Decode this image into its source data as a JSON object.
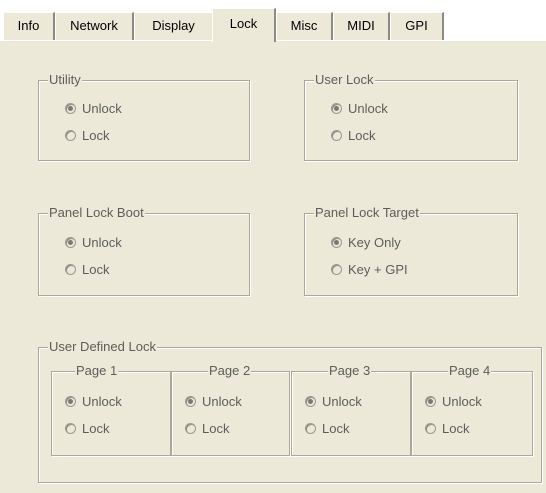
{
  "tabs": [
    {
      "label": "Info"
    },
    {
      "label": "Network"
    },
    {
      "label": "Display"
    },
    {
      "label": "Lock"
    },
    {
      "label": "Misc"
    },
    {
      "label": "MIDI"
    },
    {
      "label": "GPI"
    }
  ],
  "active_tab": "Lock",
  "utility": {
    "title": "Utility",
    "unlock": "Unlock",
    "lock": "Lock",
    "selected": "Unlock"
  },
  "user_lock": {
    "title": "User Lock",
    "unlock": "Unlock",
    "lock": "Lock",
    "selected": "Unlock"
  },
  "panel_lock_boot": {
    "title": "Panel Lock Boot",
    "unlock": "Unlock",
    "lock": "Lock",
    "selected": "Unlock"
  },
  "panel_lock_target": {
    "title": "Panel Lock Target",
    "key_only": "Key Only",
    "key_gpi": "Key + GPI",
    "selected": "Key Only"
  },
  "user_defined_lock": {
    "title": "User Defined Lock",
    "pages": [
      {
        "title": "Page 1",
        "unlock": "Unlock",
        "lock": "Lock",
        "selected": "Unlock"
      },
      {
        "title": "Page 2",
        "unlock": "Unlock",
        "lock": "Lock",
        "selected": "Unlock"
      },
      {
        "title": "Page 3",
        "unlock": "Unlock",
        "lock": "Lock",
        "selected": "Unlock"
      },
      {
        "title": "Page 4",
        "unlock": "Unlock",
        "lock": "Lock",
        "selected": "Unlock"
      }
    ]
  }
}
